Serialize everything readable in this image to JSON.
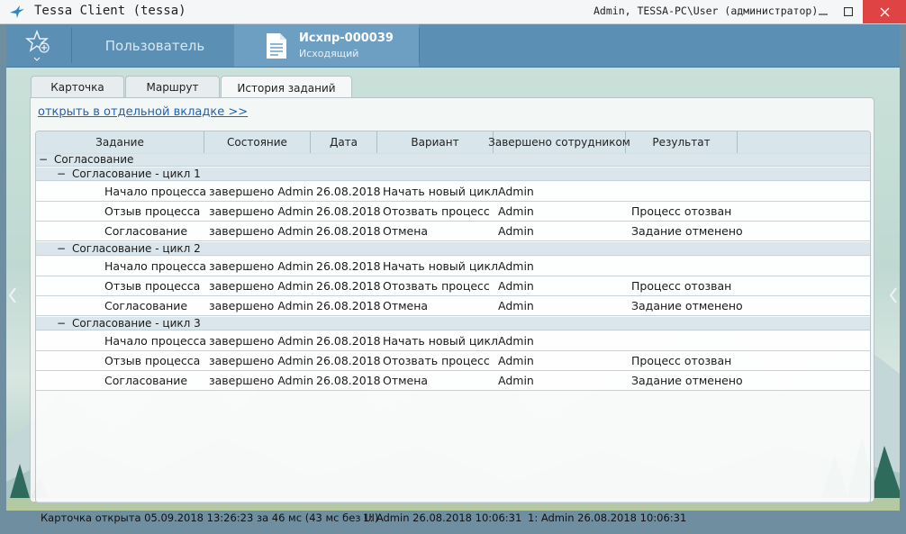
{
  "window": {
    "title": "Tessa Client (tessa)",
    "user_info": "Admin, TESSA-PC\\User (администратор)"
  },
  "toolbar": {
    "user_tab_label": "Пользователь",
    "doc_tab_title": "Исхпр-000039",
    "doc_tab_subtitle": "Исходящий"
  },
  "tabs": [
    {
      "label": "Карточка",
      "active": false
    },
    {
      "label": "Маршрут",
      "active": false
    },
    {
      "label": "История заданий",
      "active": true
    }
  ],
  "open_link": "открыть в отдельной вкладке >>",
  "columns": [
    "Задание",
    "Состояние",
    "Дата",
    "Вариант",
    "Завершено сотрудником",
    "Результат"
  ],
  "root_group": {
    "toggle": "−",
    "label": "Согласование"
  },
  "cycles": [
    {
      "toggle": "−",
      "label": "Согласование - цикл 1",
      "rows": [
        [
          "Начало процесса",
          "завершено Admin",
          "26.08.2018",
          "Начать новый цикл",
          "Admin",
          ""
        ],
        [
          "Отзыв процесса",
          "завершено Admin",
          "26.08.2018",
          "Отозвать процесс",
          "Admin",
          "Процесс отозван"
        ],
        [
          "Согласование",
          "завершено Admin",
          "26.08.2018",
          "Отмена",
          "Admin",
          "Задание отменено"
        ]
      ]
    },
    {
      "toggle": "−",
      "label": "Согласование - цикл 2",
      "rows": [
        [
          "Начало процесса",
          "завершено Admin",
          "26.08.2018",
          "Начать новый цикл",
          "Admin",
          ""
        ],
        [
          "Отзыв процесса",
          "завершено Admin",
          "26.08.2018",
          "Отозвать процесс",
          "Admin",
          "Процесс отозван"
        ],
        [
          "Согласование",
          "завершено Admin",
          "26.08.2018",
          "Отмена",
          "Admin",
          "Задание отменено"
        ]
      ]
    },
    {
      "toggle": "−",
      "label": "Согласование - цикл 3",
      "rows": [
        [
          "Начало процесса",
          "завершено Admin",
          "26.08.2018",
          "Начать новый цикл",
          "Admin",
          ""
        ],
        [
          "Отзыв процесса",
          "завершено Admin",
          "26.08.2018",
          "Отозвать процесс",
          "Admin",
          "Процесс отозван"
        ],
        [
          "Согласование",
          "завершено Admin",
          "26.08.2018",
          "Отмена",
          "Admin",
          "Задание отменено"
        ]
      ]
    }
  ],
  "status": {
    "card_opened": "Карточка открыта 05.09.2018 13:26:23 за 46 мс (43 мс без UI)",
    "item1": "1:  Admin  26.08.2018 10:06:31",
    "item2": "1:  Admin  26.08.2018 10:06:31"
  },
  "colors": {
    "toolbar": "#5b8fb3",
    "active_doc_tab": "#6c9fc2",
    "close_button": "#e04343",
    "link": "#1f63b6"
  },
  "icons": {
    "app": "bird-icon",
    "favorites": "star-plus-icon",
    "document": "document-icon",
    "minimize": "minimize-icon",
    "maximize": "maximize-icon",
    "close": "close-icon",
    "left_panel": "chevron-left-icon",
    "right_panel": "chevron-right-icon"
  }
}
